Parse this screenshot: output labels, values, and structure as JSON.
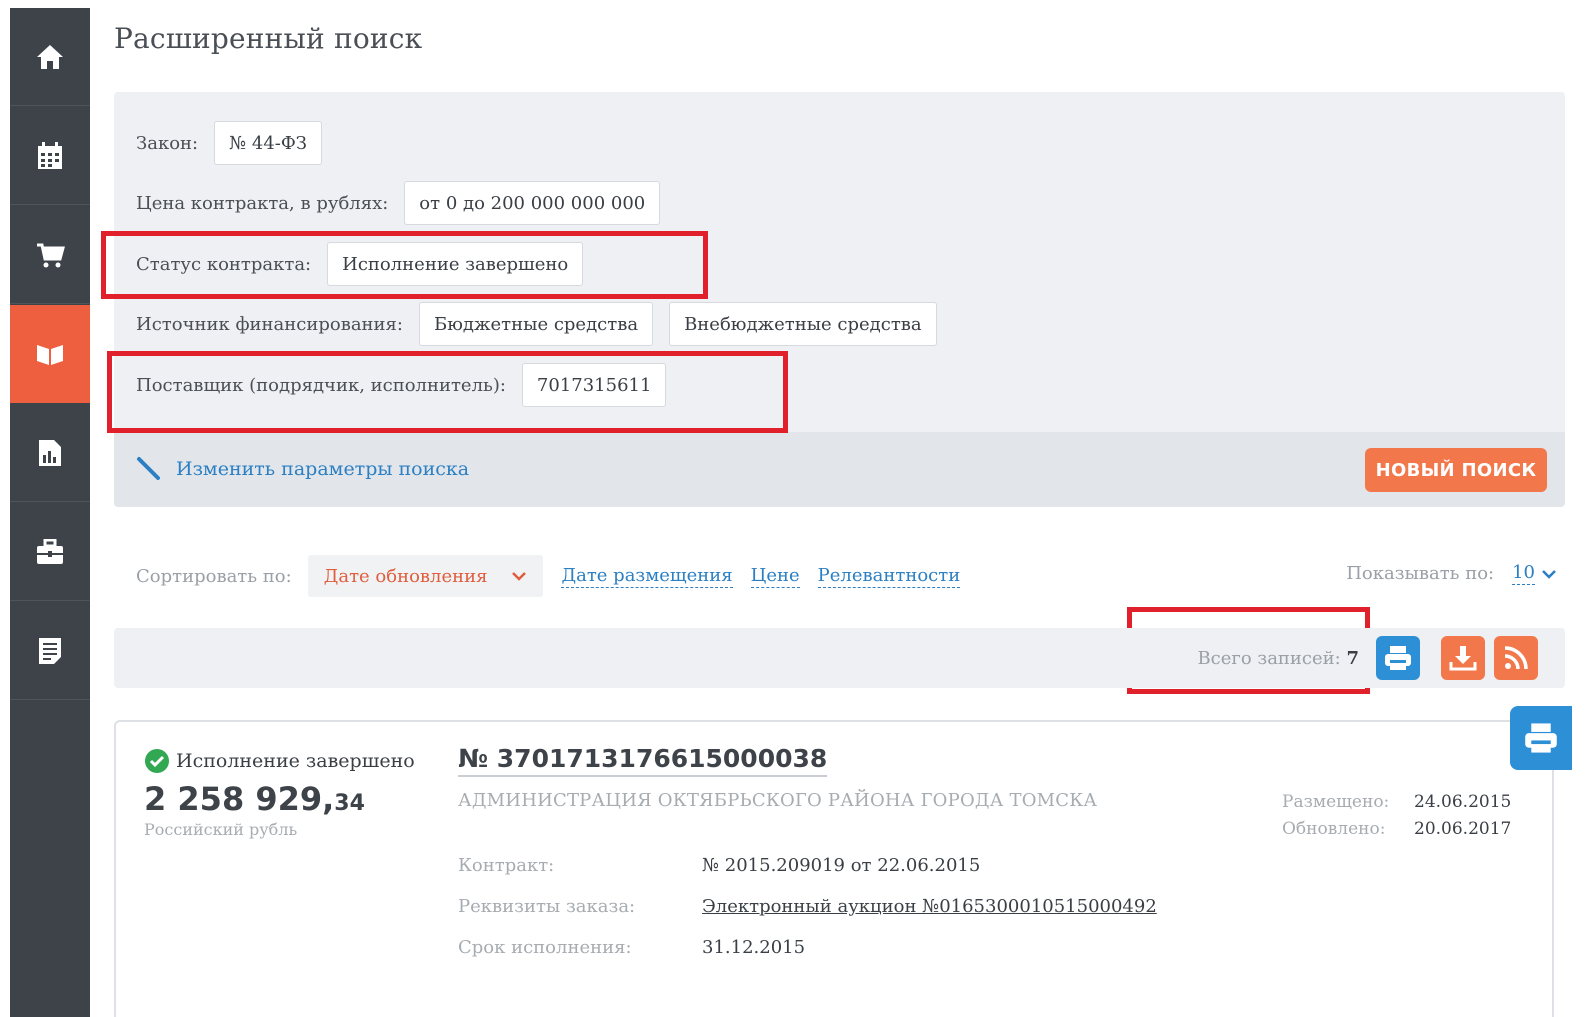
{
  "page": {
    "title": "Расширенный поиск"
  },
  "sidebar": {
    "items": [
      {
        "icon": "home-icon"
      },
      {
        "icon": "calendar-icon"
      },
      {
        "icon": "cart-icon"
      },
      {
        "icon": "contract-icon",
        "active": true
      },
      {
        "icon": "report-icon"
      },
      {
        "icon": "briefcase-icon"
      },
      {
        "icon": "document-list-icon"
      }
    ]
  },
  "filters": {
    "law": {
      "label": "Закон:",
      "value": "№ 44-ФЗ"
    },
    "price": {
      "label": "Цена контракта, в рублях:",
      "value": "от 0 до 200 000 000 000"
    },
    "status": {
      "label": "Статус контракта:",
      "value": "Исполнение завершено"
    },
    "funding": {
      "label": "Источник финансирования:",
      "values": [
        "Бюджетные средства",
        "Внебюджетные средства"
      ]
    },
    "supplier": {
      "label": "Поставщик (подрядчик, исполнитель):",
      "value": "7017315611"
    },
    "edit_link": "Изменить параметры поиска",
    "new_search": "НОВЫЙ ПОИСК"
  },
  "sort": {
    "label": "Сортировать по:",
    "selected": "Дате обновления",
    "options": [
      "Дате размещения",
      "Цене",
      "Релевантности"
    ]
  },
  "per_page": {
    "label": "Показывать по:",
    "value": "10"
  },
  "results": {
    "total_label": "Всего записей:",
    "total": "7"
  },
  "card": {
    "status": "Исполнение завершено",
    "price_main": "2 258 929,",
    "price_kop": "34",
    "currency": "Российский рубль",
    "number": "№ 3701713176615000038",
    "customer": "АДМИНИСТРАЦИЯ ОКТЯБРЬСКОГО РАЙОНА ГОРОДА ТОМСКА",
    "posted_label": "Размещено:",
    "posted": "24.06.2015",
    "updated_label": "Обновлено:",
    "updated": "20.06.2017",
    "contract_label": "Контракт:",
    "contract": "№ 2015.209019 от 22.06.2015",
    "order_label": "Реквизиты заказа:",
    "order": "Электронный аукцион №0165300010515000492",
    "deadline_label": "Срок исполнения:",
    "deadline": "31.12.2015"
  },
  "colors": {
    "sidebar": "#3d4349",
    "accent": "#ed5f3e",
    "link": "#2b7fc2",
    "annotation": "#e0212b",
    "print_button": "#2d8fd5",
    "download_button": "#f2784b"
  }
}
